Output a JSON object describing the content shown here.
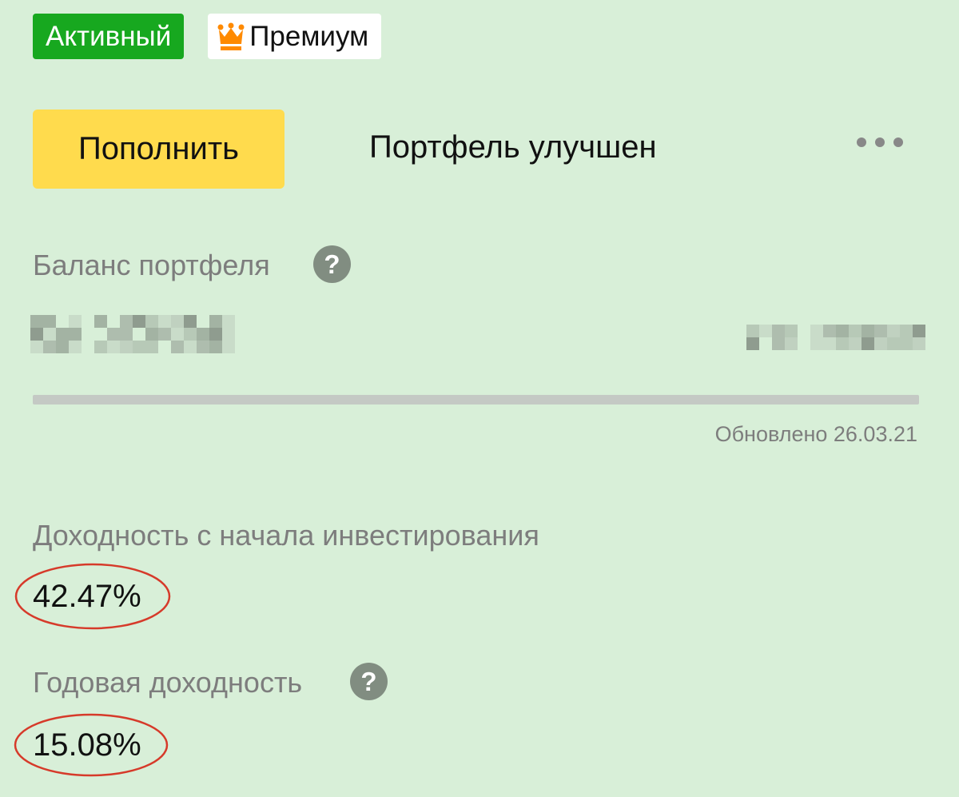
{
  "badges": {
    "status": "Активный",
    "premium": "Премиум",
    "premium_icon": "crown-icon"
  },
  "actions": {
    "topup_label": "Пополнить",
    "status_text": "Портфель улучшен",
    "more_icon": "more-dots-icon"
  },
  "balance": {
    "label": "Баланс портфеля",
    "help_icon": "help-icon",
    "updated": "Обновлено 26.03.21"
  },
  "returns": {
    "total_label": "Доходность с начала инвестирования",
    "total_value": "42.47%",
    "annual_label": "Годовая доходность",
    "annual_value": "15.08%",
    "annual_help_icon": "help-icon"
  },
  "colors": {
    "background": "#d8efd8",
    "active_badge": "#17a81f",
    "primary_button": "#ffdb4d",
    "crown": "#ff8a00",
    "annotation_ellipse": "#d63a2a"
  }
}
